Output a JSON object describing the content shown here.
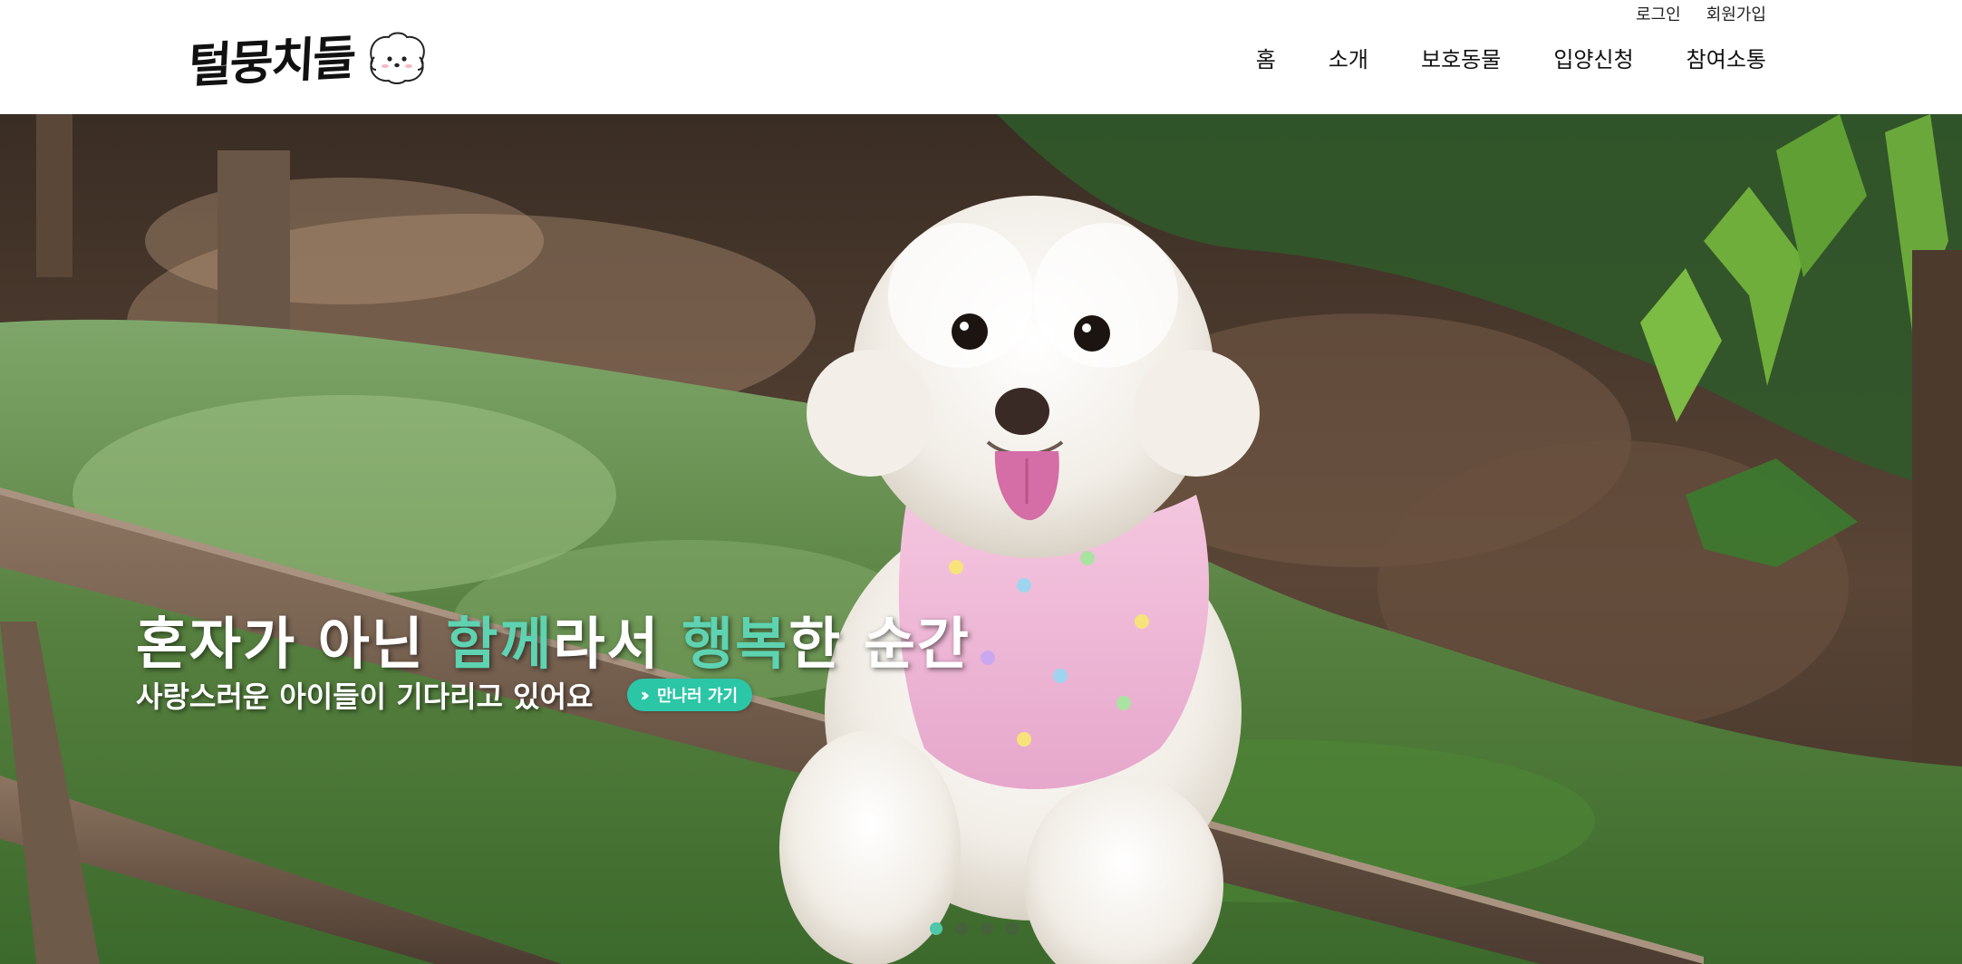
{
  "header": {
    "logo_text": "털뭉치들",
    "top_links": {
      "login": "로그인",
      "signup": "회원가입"
    },
    "nav": {
      "home": "홈",
      "about": "소개",
      "animals": "보호동물",
      "adoption": "입양신청",
      "community": "참여소통"
    }
  },
  "hero": {
    "headline": {
      "part1": "혼자가 아닌 ",
      "accent1": "함께",
      "part2": "라서 ",
      "accent2": "행복",
      "part3": "한 순간"
    },
    "subtitle": "사랑스러운 아이들이 기다리고 있어요",
    "cta_label": "만나러 가기",
    "slides_total": 4,
    "active_slide": 1
  },
  "colors": {
    "accent": "#5ed3b1",
    "button": "#2bc6a6",
    "active_dot": "#4fc7a8"
  }
}
